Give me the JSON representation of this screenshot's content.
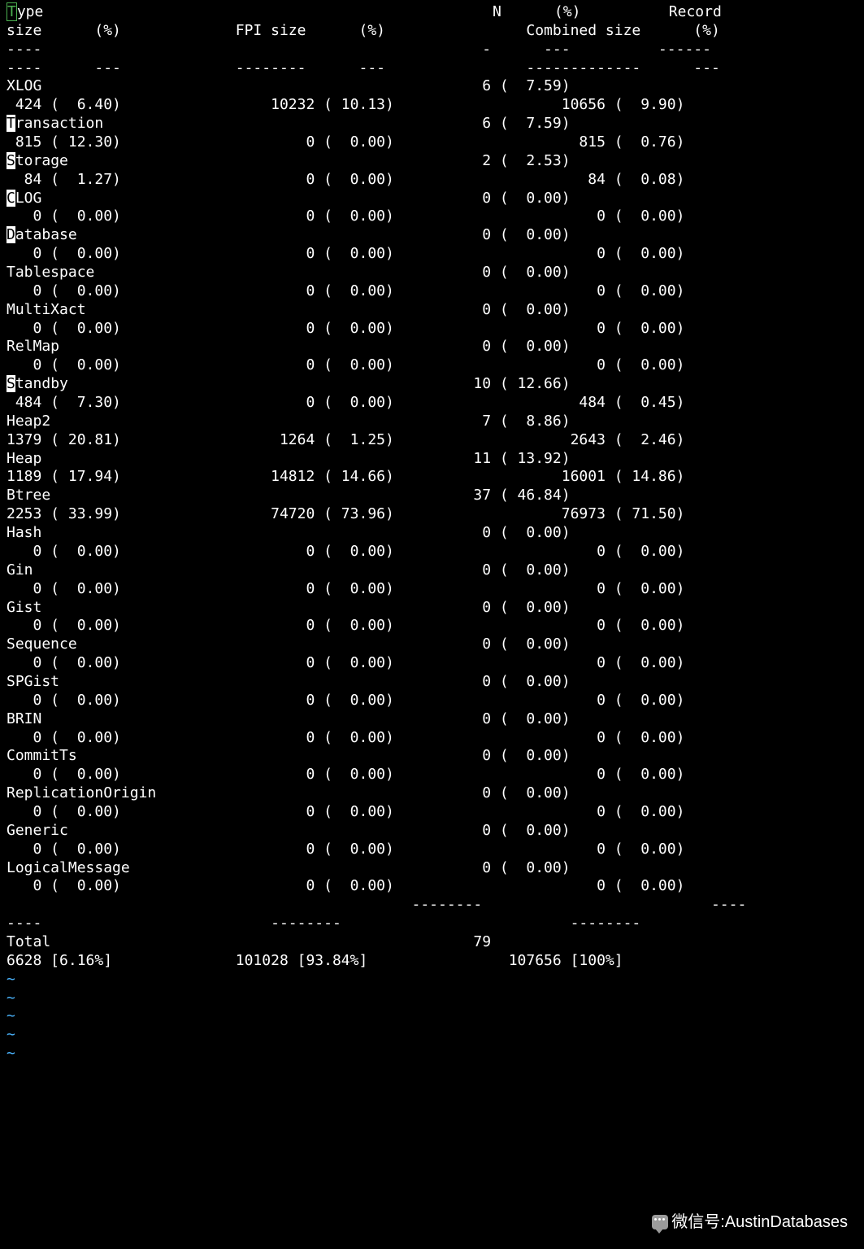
{
  "header": {
    "line1_a": "T",
    "line1_b": "ype                                                   N      (%)          Record",
    "line2": "size      (%)             FPI size      (%)                Combined size      (%)",
    "line3": "----                                                  -      ---          ------",
    "line4": "----      ---             --------      ---                -------------      ---"
  },
  "rows": [
    {
      "name": "XLOG",
      "n": 6,
      "npct": "7.59",
      "rec": 424,
      "recpct": "6.40",
      "fpi": 10232,
      "fpipct": "10.13",
      "comb": 10656,
      "combpct": "9.90",
      "hl": false
    },
    {
      "name": "Transaction",
      "n": 6,
      "npct": "7.59",
      "rec": 815,
      "recpct": "12.30",
      "fpi": 0,
      "fpipct": "0.00",
      "comb": 815,
      "combpct": "0.76",
      "hl": true
    },
    {
      "name": "Storage",
      "n": 2,
      "npct": "2.53",
      "rec": 84,
      "recpct": "1.27",
      "fpi": 0,
      "fpipct": "0.00",
      "comb": 84,
      "combpct": "0.08",
      "hl": true
    },
    {
      "name": "CLOG",
      "n": 0,
      "npct": "0.00",
      "rec": 0,
      "recpct": "0.00",
      "fpi": 0,
      "fpipct": "0.00",
      "comb": 0,
      "combpct": "0.00",
      "hl": true
    },
    {
      "name": "Database",
      "n": 0,
      "npct": "0.00",
      "rec": 0,
      "recpct": "0.00",
      "fpi": 0,
      "fpipct": "0.00",
      "comb": 0,
      "combpct": "0.00",
      "hl": true
    },
    {
      "name": "Tablespace",
      "n": 0,
      "npct": "0.00",
      "rec": 0,
      "recpct": "0.00",
      "fpi": 0,
      "fpipct": "0.00",
      "comb": 0,
      "combpct": "0.00",
      "hl": false
    },
    {
      "name": "MultiXact",
      "n": 0,
      "npct": "0.00",
      "rec": 0,
      "recpct": "0.00",
      "fpi": 0,
      "fpipct": "0.00",
      "comb": 0,
      "combpct": "0.00",
      "hl": false
    },
    {
      "name": "RelMap",
      "n": 0,
      "npct": "0.00",
      "rec": 0,
      "recpct": "0.00",
      "fpi": 0,
      "fpipct": "0.00",
      "comb": 0,
      "combpct": "0.00",
      "hl": false
    },
    {
      "name": "Standby",
      "n": 10,
      "npct": "12.66",
      "rec": 484,
      "recpct": "7.30",
      "fpi": 0,
      "fpipct": "0.00",
      "comb": 484,
      "combpct": "0.45",
      "hl": true
    },
    {
      "name": "Heap2",
      "n": 7,
      "npct": "8.86",
      "rec": 1379,
      "recpct": "20.81",
      "fpi": 1264,
      "fpipct": "1.25",
      "comb": 2643,
      "combpct": "2.46",
      "hl": false
    },
    {
      "name": "Heap",
      "n": 11,
      "npct": "13.92",
      "rec": 1189,
      "recpct": "17.94",
      "fpi": 14812,
      "fpipct": "14.66",
      "comb": 16001,
      "combpct": "14.86",
      "hl": false
    },
    {
      "name": "Btree",
      "n": 37,
      "npct": "46.84",
      "rec": 2253,
      "recpct": "33.99",
      "fpi": 74720,
      "fpipct": "73.96",
      "comb": 76973,
      "combpct": "71.50",
      "hl": false
    },
    {
      "name": "Hash",
      "n": 0,
      "npct": "0.00",
      "rec": 0,
      "recpct": "0.00",
      "fpi": 0,
      "fpipct": "0.00",
      "comb": 0,
      "combpct": "0.00",
      "hl": false
    },
    {
      "name": "Gin",
      "n": 0,
      "npct": "0.00",
      "rec": 0,
      "recpct": "0.00",
      "fpi": 0,
      "fpipct": "0.00",
      "comb": 0,
      "combpct": "0.00",
      "hl": false
    },
    {
      "name": "Gist",
      "n": 0,
      "npct": "0.00",
      "rec": 0,
      "recpct": "0.00",
      "fpi": 0,
      "fpipct": "0.00",
      "comb": 0,
      "combpct": "0.00",
      "hl": false
    },
    {
      "name": "Sequence",
      "n": 0,
      "npct": "0.00",
      "rec": 0,
      "recpct": "0.00",
      "fpi": 0,
      "fpipct": "0.00",
      "comb": 0,
      "combpct": "0.00",
      "hl": false
    },
    {
      "name": "SPGist",
      "n": 0,
      "npct": "0.00",
      "rec": 0,
      "recpct": "0.00",
      "fpi": 0,
      "fpipct": "0.00",
      "comb": 0,
      "combpct": "0.00",
      "hl": false
    },
    {
      "name": "BRIN",
      "n": 0,
      "npct": "0.00",
      "rec": 0,
      "recpct": "0.00",
      "fpi": 0,
      "fpipct": "0.00",
      "comb": 0,
      "combpct": "0.00",
      "hl": false
    },
    {
      "name": "CommitTs",
      "n": 0,
      "npct": "0.00",
      "rec": 0,
      "recpct": "0.00",
      "fpi": 0,
      "fpipct": "0.00",
      "comb": 0,
      "combpct": "0.00",
      "hl": false
    },
    {
      "name": "ReplicationOrigin",
      "n": 0,
      "npct": "0.00",
      "rec": 0,
      "recpct": "0.00",
      "fpi": 0,
      "fpipct": "0.00",
      "comb": 0,
      "combpct": "0.00",
      "hl": false
    },
    {
      "name": "Generic",
      "n": 0,
      "npct": "0.00",
      "rec": 0,
      "recpct": "0.00",
      "fpi": 0,
      "fpipct": "0.00",
      "comb": 0,
      "combpct": "0.00",
      "hl": false
    },
    {
      "name": "LogicalMessage",
      "n": 0,
      "npct": "0.00",
      "rec": 0,
      "recpct": "0.00",
      "fpi": 0,
      "fpipct": "0.00",
      "comb": 0,
      "combpct": "0.00",
      "hl": false
    }
  ],
  "sep1": "                                              --------                          ----",
  "sep2": "----                          --------                          --------",
  "total": {
    "label": "Total",
    "n": 79,
    "rec": 6628,
    "recpct": "6.16%",
    "fpi": 101028,
    "fpipct": "93.84%",
    "comb": 107656,
    "combpct": "100%"
  },
  "tildes": [
    "~",
    "~",
    "~",
    "~",
    "~"
  ],
  "footer": {
    "label": "微信号",
    "value": "AustinDatabases"
  }
}
